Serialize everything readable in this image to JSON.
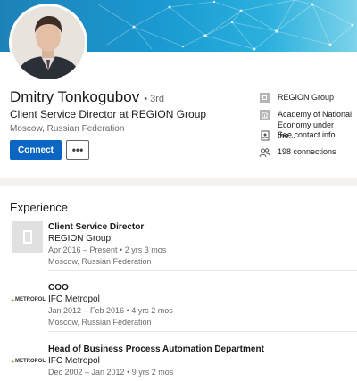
{
  "profile": {
    "name": "Dmitry Tonkogubov",
    "degree": "• 3rd",
    "headline": "Client Service Director at REGION Group",
    "location": "Moscow, Russian Federation",
    "connect_label": "Connect",
    "more_label": "•••"
  },
  "sidebar": {
    "current_company": "REGION Group",
    "education": "Academy of National Economy under the...",
    "contact_info": "See contact info",
    "connections": "198 connections"
  },
  "experience": {
    "title": "Experience",
    "items": [
      {
        "role": "Client Service Director",
        "company": "REGION Group",
        "dates": "Apr 2016 – Present  •  2 yrs 3 mos",
        "location": "Moscow, Russian Federation",
        "logo": "building-placeholder-icon"
      },
      {
        "role": "COO",
        "company": "IFC Metropol",
        "dates": "Jan 2012 – Feb 2016  •  4 yrs 2 mos",
        "location": "Moscow, Russian Federation",
        "logo": "metropol-logo",
        "logo_text": "METROPOL"
      },
      {
        "role": "Head of Business Process Automation Department",
        "company": "IFC Metropol",
        "dates": "Dec 2002 – Jan 2012  •  9 yrs 2 mos",
        "logo": "metropol-logo",
        "logo_text": "METROPOL"
      }
    ]
  },
  "colors": {
    "primary_button": "#0a66c2",
    "banner": "#1a9ad1",
    "metropol_mark": "#8aa52a"
  }
}
